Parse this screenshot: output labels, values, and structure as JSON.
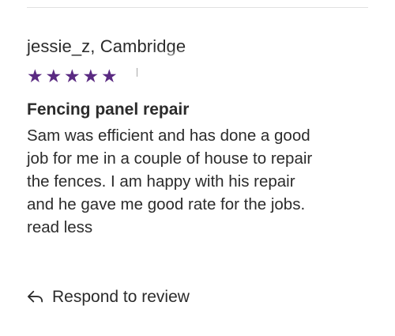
{
  "review": {
    "reviewer": "jessie_z, Cambridge",
    "rating": {
      "value": 5,
      "max": 5,
      "star_color": "#5a2a82"
    },
    "stars": [
      "★",
      "★",
      "★",
      "★",
      "★"
    ],
    "title": "Fencing panel repair",
    "body_lines": [
      "Sam was efficient and has done a good",
      "job for me in a couple of house to repair",
      "the fences. I am happy with his repair",
      "and he gave me good rate for the jobs."
    ],
    "read_less_label": "read less"
  },
  "actions": {
    "respond_label": "Respond to review",
    "respond_icon": "reply-arrow-icon"
  }
}
